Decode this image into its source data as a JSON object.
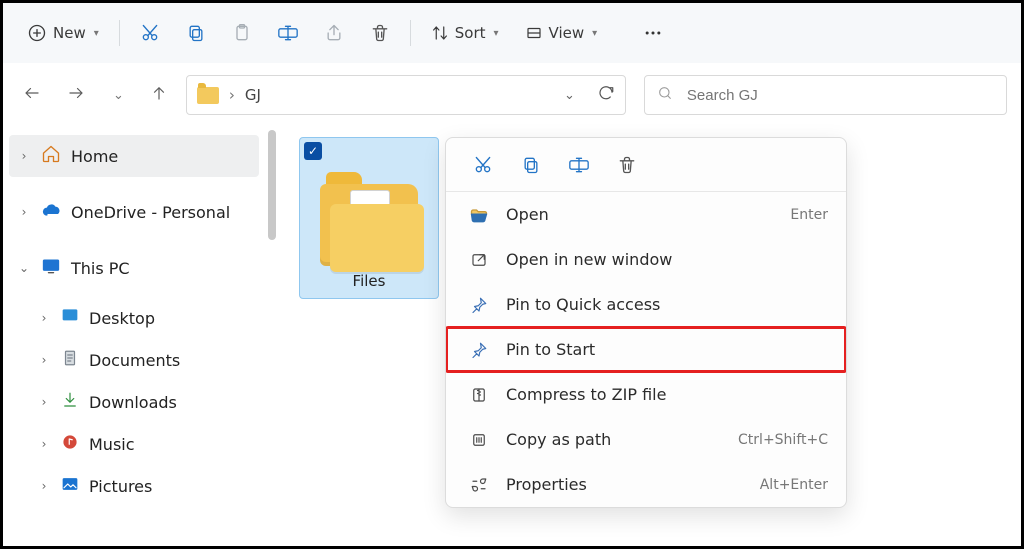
{
  "toolbar": {
    "new_label": "New",
    "sort_label": "Sort",
    "view_label": "View"
  },
  "breadcrumb": {
    "current": "GJ"
  },
  "search": {
    "placeholder": "Search GJ"
  },
  "sidebar": {
    "home": "Home",
    "onedrive": "OneDrive - Personal",
    "this_pc": "This PC",
    "desktop": "Desktop",
    "documents": "Documents",
    "downloads": "Downloads",
    "music": "Music",
    "pictures": "Pictures"
  },
  "tile": {
    "label": "Files"
  },
  "context_menu": {
    "open": "Open",
    "open_shortcut": "Enter",
    "open_new_window": "Open in new window",
    "pin_quick": "Pin to Quick access",
    "pin_start": "Pin to Start",
    "compress": "Compress to ZIP file",
    "copy_path": "Copy as path",
    "copy_path_shortcut": "Ctrl+Shift+C",
    "properties": "Properties",
    "properties_shortcut": "Alt+Enter"
  }
}
